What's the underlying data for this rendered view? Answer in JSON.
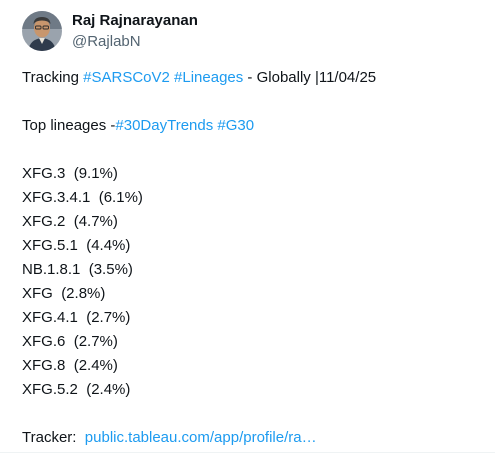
{
  "author": {
    "display_name": "Raj Rajnarayanan",
    "handle": "@RajlabN"
  },
  "tweet": {
    "line1": {
      "prefix": "Tracking ",
      "hashtag1": "#SARSCoV2",
      "space": " ",
      "hashtag2": "#Lineages",
      "suffix": " - Globally |11/04/25"
    },
    "line2": {
      "prefix": "Top lineages -",
      "hashtag1": "#30DayTrends",
      "space": " ",
      "hashtag2": "#G30"
    },
    "lineages": [
      {
        "name": "XFG.3",
        "share": "(9.1%)"
      },
      {
        "name": "XFG.3.4.1",
        "share": "(6.1%)"
      },
      {
        "name": "XFG.2",
        "share": "(4.7%)"
      },
      {
        "name": "XFG.5.1",
        "share": "(4.4%)"
      },
      {
        "name": "NB.1.8.1",
        "share": "(3.5%)"
      },
      {
        "name": "XFG",
        "share": "(2.8%)"
      },
      {
        "name": "XFG.4.1",
        "share": "(2.7%)"
      },
      {
        "name": "XFG.6",
        "share": "(2.7%)"
      },
      {
        "name": "XFG.8",
        "share": "(2.4%)"
      },
      {
        "name": "XFG.5.2",
        "share": "(2.4%)"
      }
    ],
    "tracker": {
      "label": "Tracker:",
      "link_text": "public.tableau.com/app/profile/ra…"
    }
  },
  "colors": {
    "text": "#0f1419",
    "secondary": "#536471",
    "link": "#1d9bf0"
  }
}
